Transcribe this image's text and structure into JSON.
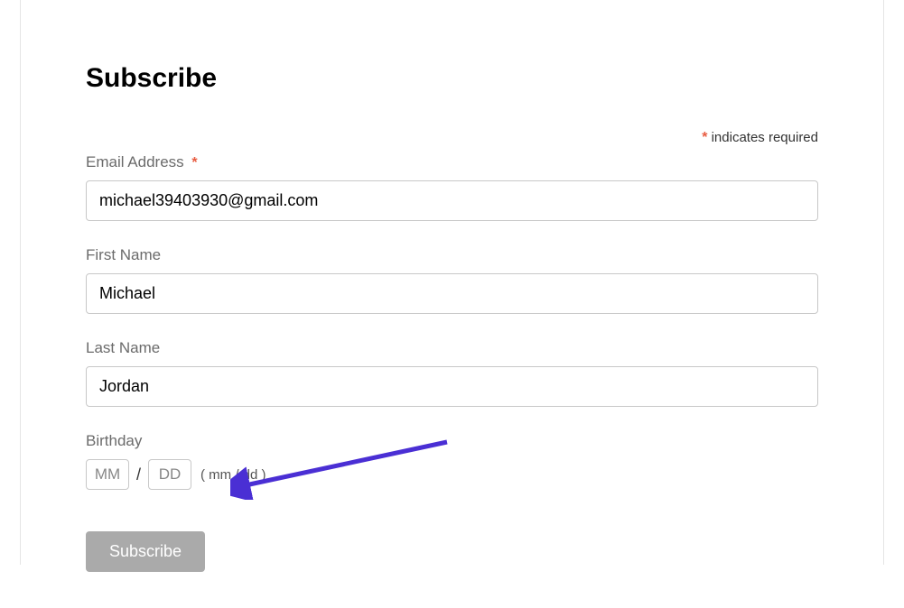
{
  "title": "Subscribe",
  "requiredNote": {
    "asterisk": "*",
    "text": " indicates required"
  },
  "form": {
    "email": {
      "label": "Email Address ",
      "asterisk": "*",
      "value": "michael39403930@gmail.com"
    },
    "firstName": {
      "label": "First Name",
      "value": "Michael"
    },
    "lastName": {
      "label": "Last Name",
      "value": "Jordan"
    },
    "birthday": {
      "label": "Birthday",
      "monthPlaceholder": "MM",
      "dayPlaceholder": "DD",
      "monthValue": "",
      "dayValue": "",
      "slash": "/",
      "hint": "( mm / dd )"
    },
    "submitLabel": "Subscribe"
  }
}
